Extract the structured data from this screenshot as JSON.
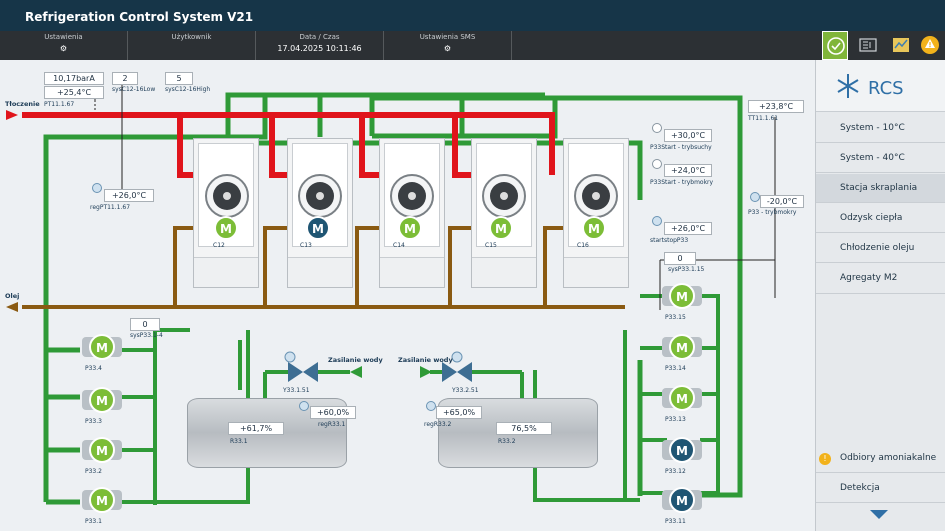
{
  "app": {
    "title": "Refrigeration Control System V21"
  },
  "header": {
    "settings_label": "Ustawienia",
    "user_label": "Użytkownik",
    "datetime_label": "Data / Czas",
    "datetime_value": "17.04.2025 10:11:46",
    "sms_label": "Ustawienia SMS"
  },
  "sidebar": {
    "brand": "RCS",
    "items": [
      {
        "label": "System - 10°C"
      },
      {
        "label": "System - 40°C"
      },
      {
        "label": "Stacja skraplania"
      },
      {
        "label": "Odzysk ciepła"
      },
      {
        "label": "Chłodzenie oleju"
      },
      {
        "label": "Agregaty M2"
      }
    ],
    "bottom_items": [
      {
        "label": "Odbiory amoniakalne"
      },
      {
        "label": "Detekcja"
      }
    ]
  },
  "process": {
    "discharge_label": "Tłoczenie",
    "return_label": "Olej",
    "pressure_value": "10,17barA",
    "pt_temp": "+25,4°C",
    "pt_tag": "PT11.1.67",
    "setpoint_low": "2",
    "setpoint_low_tag": "sysC12-16Low",
    "setpoint_high": "5",
    "setpoint_high_tag": "sysC12-16High",
    "reg_temp": "+26,0°C",
    "reg_tag": "regPT11.1.67",
    "tt_temp": "+23,8°C",
    "tt_tag": "TT11.1.61",
    "p33_start_dry": "+30,0°C",
    "p33_start_dry_tag": "P33Start - trybsuchy",
    "p33_start_wet": "+24,0°C",
    "p33_start_wet_tag": "P33Start - trybmokry",
    "start_stop": "+26,0°C",
    "start_stop_tag": "startstopP33",
    "p33_wet_value": "-20,0°C",
    "p33_wet_tag": "P33 - trybmokry",
    "sys_right_value": "0",
    "sys_right_tag": "sysP33.1.15",
    "sys_left_value": "0",
    "sys_left_tag": "sysP33.1-4",
    "water_supply_1": "Zasilanie wody",
    "water_supply_2": "Zasilanie wody",
    "valve1_tag": "Y33.1.51",
    "valve2_tag": "Y33.2.51",
    "tank1_level": "+61,7%",
    "tank1_tag": "R33.1",
    "tank1_reg": "+60,0%",
    "tank1_reg_tag": "regR33.1",
    "tank2_level": "76,5%",
    "tank2_tag": "R33.2",
    "tank2_reg": "+65,0%",
    "tank2_reg_tag": "regR33.2",
    "condensers": [
      {
        "tag": "C12",
        "status": "running"
      },
      {
        "tag": "C13",
        "status": "stopped"
      },
      {
        "tag": "C14",
        "status": "running"
      },
      {
        "tag": "C15",
        "status": "running"
      },
      {
        "tag": "C16",
        "status": "running"
      }
    ],
    "left_pumps": [
      {
        "tag": "P33.4",
        "status": "running"
      },
      {
        "tag": "P33.3",
        "status": "running"
      },
      {
        "tag": "P33.2",
        "status": "running"
      },
      {
        "tag": "P33.1",
        "status": "running"
      }
    ],
    "right_pumps": [
      {
        "tag": "P33.15",
        "status": "running"
      },
      {
        "tag": "P33.14",
        "status": "running"
      },
      {
        "tag": "P33.13",
        "status": "running"
      },
      {
        "tag": "P33.12",
        "status": "stopped"
      },
      {
        "tag": "P33.11",
        "status": "stopped"
      }
    ]
  },
  "colors": {
    "title_bar": "#163548",
    "header": "#2c3034",
    "hot_gas": "#e0141b",
    "water": "#2f9a37",
    "oil": "#8a5a12",
    "motor_running": "#7cbd37",
    "motor_stopped": "#1f5573",
    "alarm": "#f2b21b"
  },
  "icons": {
    "settings": "gear-icon",
    "ack": "check-circle-icon",
    "alarm": "warning-icon"
  }
}
